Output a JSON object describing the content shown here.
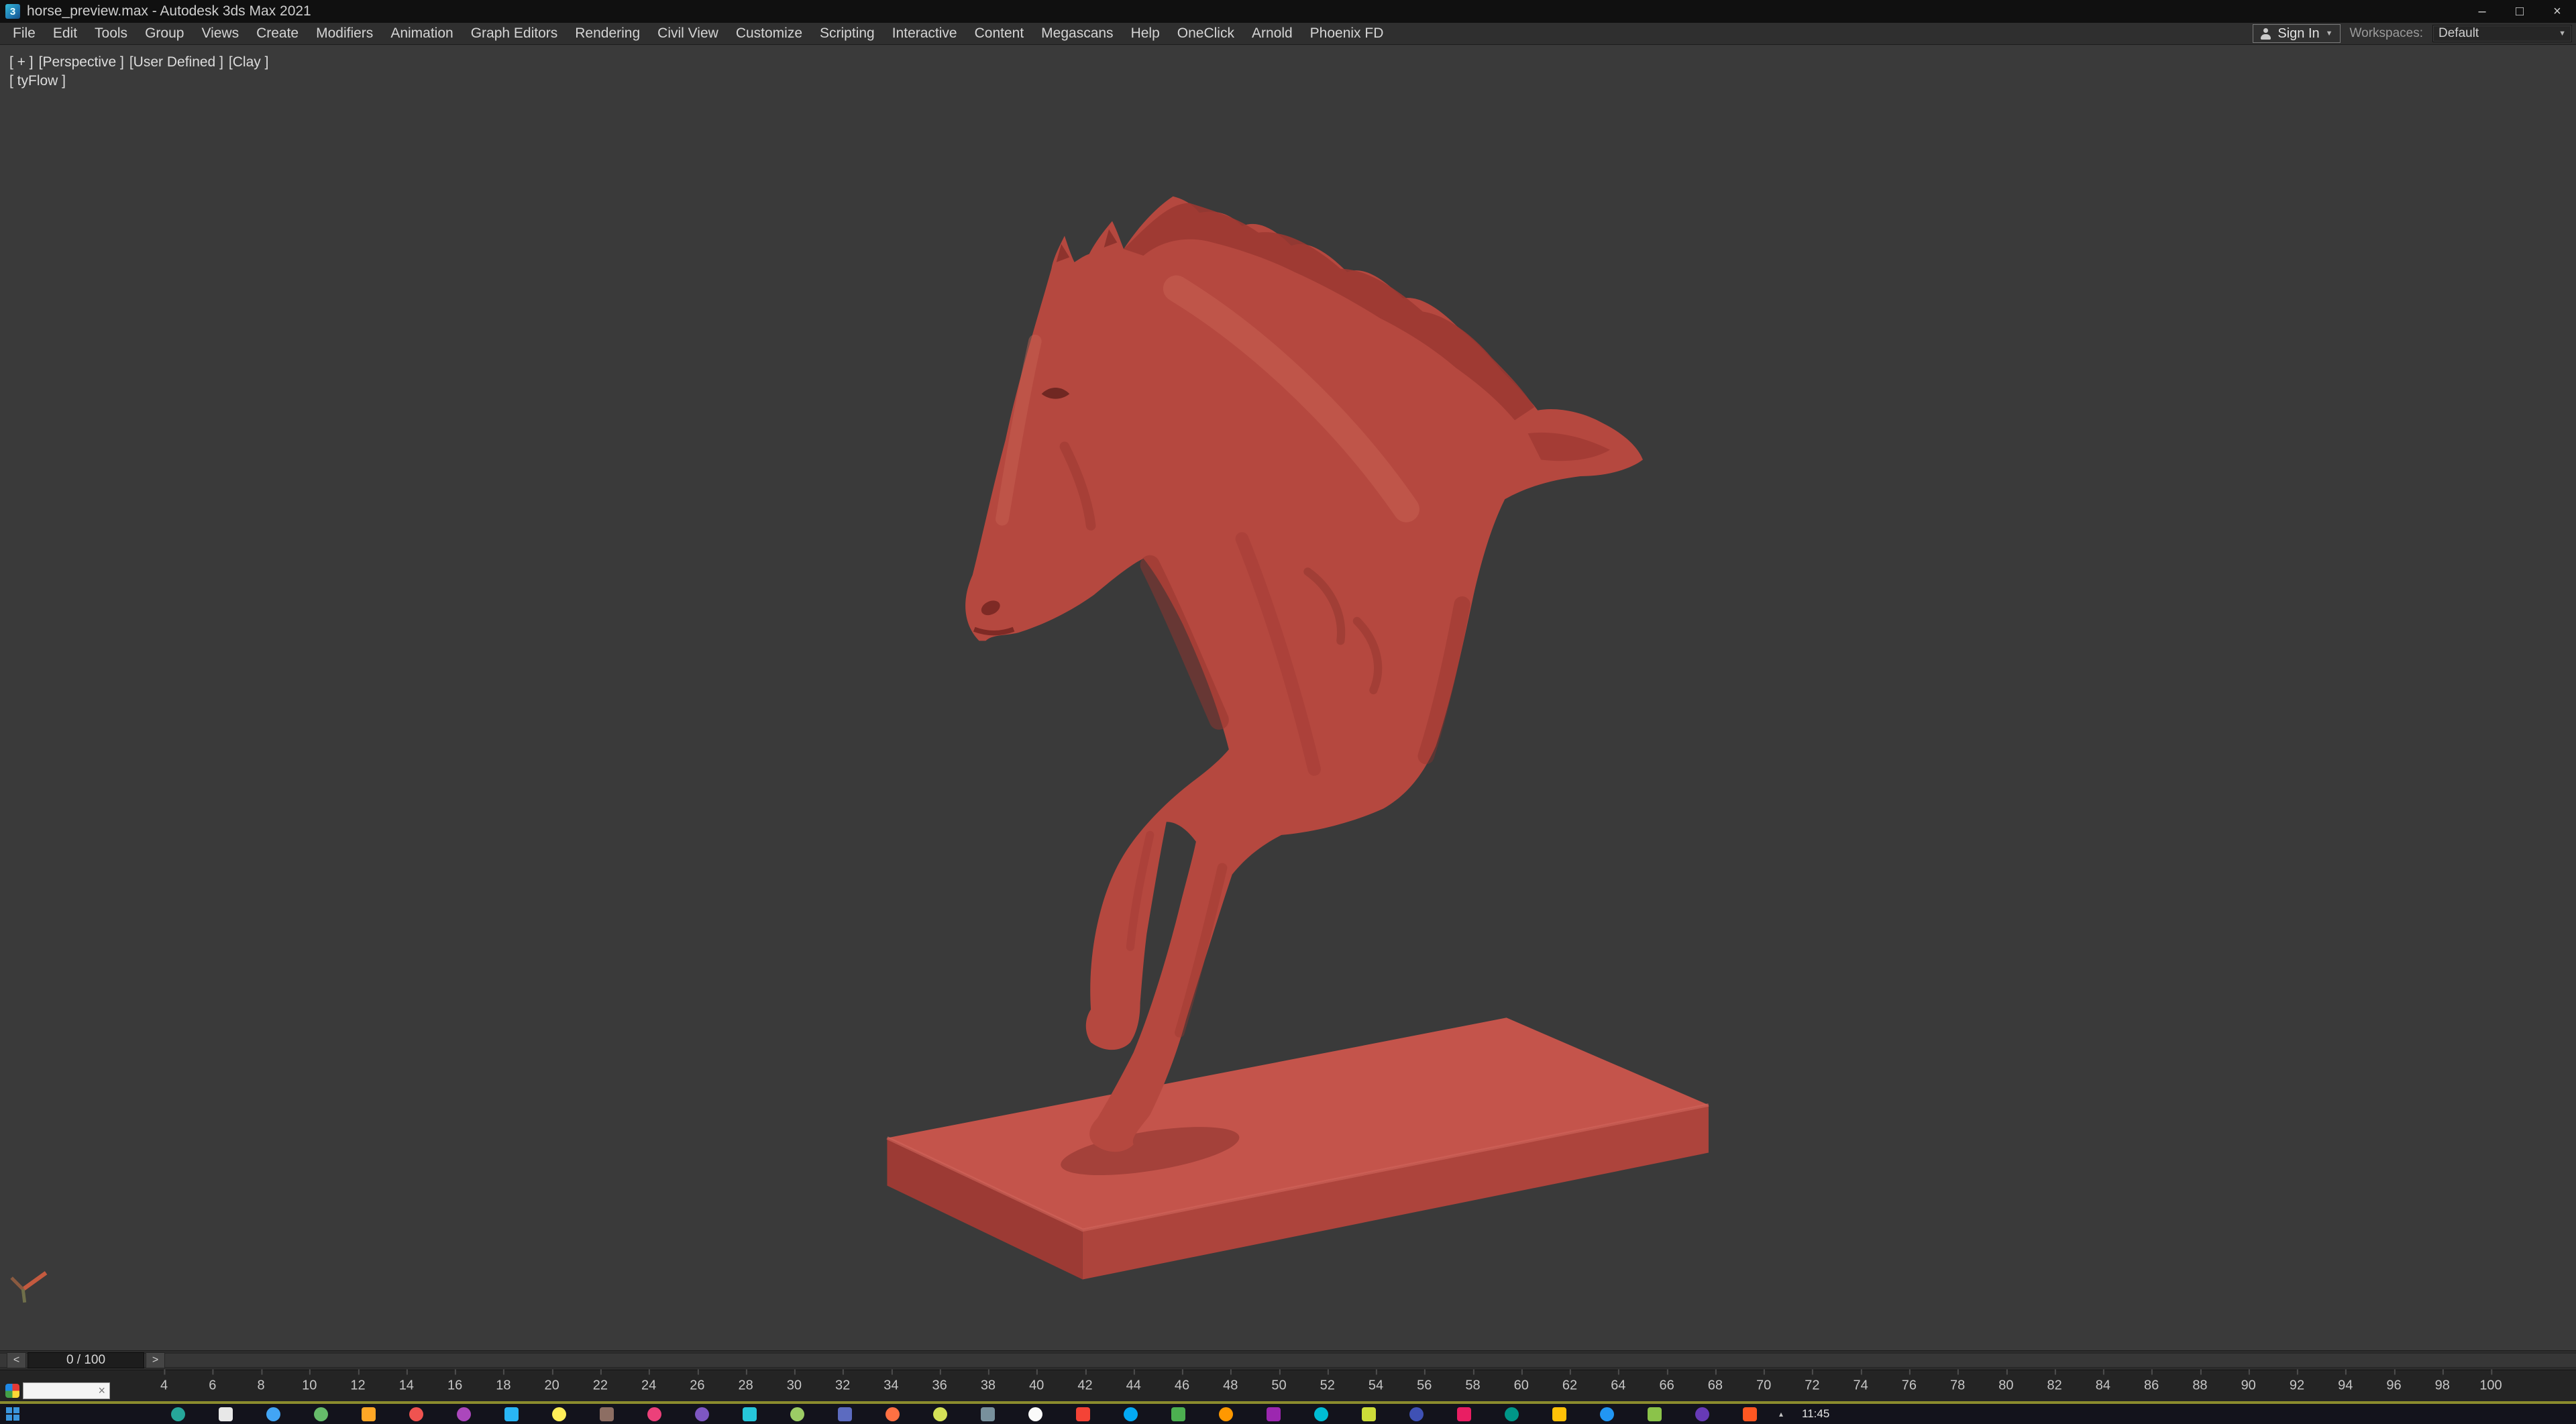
{
  "window": {
    "title": "horse_preview.max - Autodesk 3ds Max 2021",
    "minimize": "–",
    "maximize": "□",
    "close": "×"
  },
  "menu": {
    "items": [
      "File",
      "Edit",
      "Tools",
      "Group",
      "Views",
      "Create",
      "Modifiers",
      "Animation",
      "Graph Editors",
      "Rendering",
      "Civil View",
      "Customize",
      "Scripting",
      "Interactive",
      "Content",
      "Megascans",
      "Help",
      "OneClick",
      "Arnold",
      "Phoenix FD"
    ]
  },
  "account": {
    "sign_in": "Sign In",
    "dropdown_glyph": "▼",
    "workspaces_label": "Workspaces:",
    "workspace": "Default"
  },
  "viewport": {
    "labels": [
      "[ + ]",
      "[Perspective ]",
      "[User Defined ]",
      "[Clay ]"
    ],
    "sublabel": "[ tyFlow ]"
  },
  "timeline": {
    "value": "0 / 100",
    "prev": "<",
    "next": ">",
    "ticks": [
      4,
      6,
      8,
      10,
      12,
      14,
      16,
      18,
      20,
      22,
      24,
      26,
      28,
      30,
      32,
      34,
      36,
      38,
      40,
      42,
      44,
      46,
      48,
      50,
      52,
      54,
      56,
      58,
      60,
      62,
      64,
      66,
      68,
      70,
      72,
      74,
      76,
      78,
      80,
      82,
      84,
      86,
      88,
      90,
      92,
      94,
      96,
      98,
      100
    ]
  },
  "minipanel": {
    "close": "×"
  },
  "taskbar": {
    "tray_chevron": "▴",
    "clock": "11:45",
    "apps": [
      {
        "color": "#26a69a",
        "shape": "circle"
      },
      {
        "color": "#e8e8e8",
        "shape": "square"
      },
      {
        "color": "#42a5f5",
        "shape": "circle"
      },
      {
        "color": "#66bb6a",
        "shape": "circle"
      },
      {
        "color": "#ffa726",
        "shape": "square"
      },
      {
        "color": "#ef5350",
        "shape": "circle"
      },
      {
        "color": "#ab47bc",
        "shape": "circle"
      },
      {
        "color": "#29b6f6",
        "shape": "square"
      },
      {
        "color": "#ffee58",
        "shape": "circle"
      },
      {
        "color": "#8d6e63",
        "shape": "square"
      },
      {
        "color": "#ec407a",
        "shape": "circle"
      },
      {
        "color": "#7e57c2",
        "shape": "circle"
      },
      {
        "color": "#26c6da",
        "shape": "square"
      },
      {
        "color": "#9ccc65",
        "shape": "circle"
      },
      {
        "color": "#5c6bc0",
        "shape": "square"
      },
      {
        "color": "#ff7043",
        "shape": "circle"
      },
      {
        "color": "#d4e157",
        "shape": "circle"
      },
      {
        "color": "#78909c",
        "shape": "square"
      },
      {
        "color": "#fafafa",
        "shape": "circle"
      },
      {
        "color": "#f44336",
        "shape": "square"
      },
      {
        "color": "#03a9f4",
        "shape": "circle"
      },
      {
        "color": "#4caf50",
        "shape": "square"
      },
      {
        "color": "#ff9800",
        "shape": "circle"
      },
      {
        "color": "#9c27b0",
        "shape": "square"
      },
      {
        "color": "#00bcd4",
        "shape": "circle"
      },
      {
        "color": "#cddc39",
        "shape": "square"
      },
      {
        "color": "#3f51b5",
        "shape": "circle"
      },
      {
        "color": "#e91e63",
        "shape": "square"
      },
      {
        "color": "#009688",
        "shape": "circle"
      },
      {
        "color": "#ffc107",
        "shape": "square"
      },
      {
        "color": "#2196f3",
        "shape": "circle"
      },
      {
        "color": "#8bc34a",
        "shape": "square"
      },
      {
        "color": "#673ab7",
        "shape": "circle"
      },
      {
        "color": "#ff5722",
        "shape": "square"
      }
    ]
  },
  "colors": {
    "viewport_bg": "#3a3a3a",
    "clay_body": "#b5483f",
    "clay_top": "#c4544b",
    "clay_dark": "#9c3a34",
    "clay_mid": "#ad443c",
    "trackbar_highlight": "#8b8b2d"
  }
}
